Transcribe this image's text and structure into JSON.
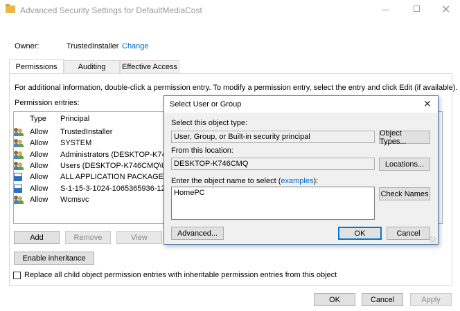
{
  "window": {
    "title": "Advanced Security Settings for DefaultMediaCost",
    "owner_label": "Owner:",
    "owner_value": "TrustedInstaller",
    "change_link": "Change"
  },
  "tabs": [
    {
      "label": "Permissions"
    },
    {
      "label": "Auditing"
    },
    {
      "label": "Effective Access"
    }
  ],
  "info_text": "For additional information, double-click a permission entry. To modify a permission entry, select the entry and click Edit (if available).",
  "entries_label": "Permission entries:",
  "columns": {
    "type": "Type",
    "principal": "Principal"
  },
  "entries": [
    {
      "icon": "user-group-icon",
      "type": "Allow",
      "principal": "TrustedInstaller"
    },
    {
      "icon": "user-group-icon",
      "type": "Allow",
      "principal": "SYSTEM"
    },
    {
      "icon": "user-group-icon",
      "type": "Allow",
      "principal": "Administrators (DESKTOP-K74..."
    },
    {
      "icon": "user-group-icon",
      "type": "Allow",
      "principal": "Users (DESKTOP-K746CMQ\\U..."
    },
    {
      "icon": "package-icon",
      "type": "Allow",
      "principal": "ALL APPLICATION PACKAGES"
    },
    {
      "icon": "package-icon",
      "type": "Allow",
      "principal": "S-1-15-3-1024-1065365936-12..."
    },
    {
      "icon": "user-group-icon",
      "type": "Allow",
      "principal": "Wcmsvc"
    }
  ],
  "buttons": {
    "add": "Add",
    "remove": "Remove",
    "view": "View",
    "enable_inheritance": "Enable inheritance",
    "ok": "OK",
    "cancel": "Cancel",
    "apply": "Apply"
  },
  "replace_checkbox": "Replace all child object permission entries with inheritable permission entries from this object",
  "dialog": {
    "title": "Select User or Group",
    "object_type_label": "Select this object type:",
    "object_type_value": "User, Group, or Built-in security principal",
    "object_types_btn": "Object Types...",
    "location_label": "From this location:",
    "location_value": "DESKTOP-K746CMQ",
    "locations_btn": "Locations...",
    "enter_label": "Enter the object name to select (",
    "examples_link": "examples",
    "enter_label_end": "):",
    "name_value": "HomePC",
    "check_names_btn": "Check Names",
    "advanced_btn": "Advanced...",
    "ok_btn": "OK",
    "cancel_btn": "Cancel"
  },
  "colors": {
    "accent": "#0078d7",
    "link": "#0066cc",
    "dialog_border": "#3c6fa8"
  }
}
